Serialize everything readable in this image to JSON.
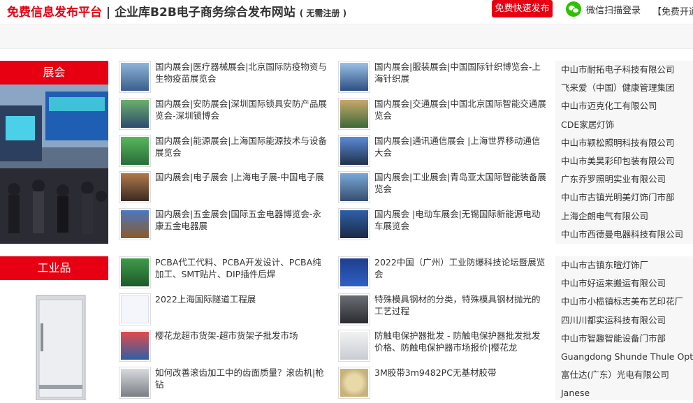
{
  "header": {
    "brand_red": "免费信息发布平台",
    "brand_sep": "|",
    "brand_main": "企业库B2B电子商务综合发布网站",
    "brand_note": "( 无需注册 )",
    "publish_button": "免费快速发布",
    "wechat_login": "微信扫描登录",
    "free_open": "【免费开通"
  },
  "exhibition": {
    "title": "展会",
    "left_col": [
      "国内展会|医疗器械展会|北京国际防疫物资与生物疫苗展览会",
      "国内展会|安防展会|深圳国际锁具安防产品展览会-深圳锁博会",
      "国内展会|能源展会|上海国际能源技术与设备展览会",
      "国内展会|电子展会 |上海电子展-中国电子展",
      "国内展会|五金展会|国际五金电器博览会-永康五金电器展"
    ],
    "right_col": [
      "国内展会|服装展会|中国国际针织博览会-上海针织展",
      "国内展会|交通展会|中国北京国际智能交通展览会",
      "国内展会|通讯通信展会 |上海世界移动通信大会",
      "国内展会|工业展会|青岛亚太国际智能装备展览会",
      "国内展会 |电动车展会|无锡国际新能源电动车展览会"
    ],
    "companies": [
      "中山市耐拓电子科技有限公司",
      "飞来爱（中国）健康管理集团",
      "中山市迈克化工有限公司",
      "CDE家居灯饰",
      "中山市颖松照明科技有限公司",
      "中山市美昊彩印包装有限公司",
      "广东乔罗照明实业有限公司",
      "中山市古镇光明美灯饰门市部",
      "上海企朗电气有限公司",
      "中山市西德曼电器科技有限公司"
    ]
  },
  "industrial": {
    "title": "工业品",
    "left_col": [
      "PCBA代工代料、PCBA开发设计、PCBA纯加工、SMT贴片、DIP插件后焊",
      "2022上海国际隧道工程展",
      "樱花龙超市货架-超市货架子批发市场",
      "如何改善滚齿加工中的齿面质量？滚齿机|枪钻"
    ],
    "right_col": [
      "2022中国（广州）工业防爆科技论坛暨展览会",
      "特殊模具钢材的分类，特殊模具钢材抛光的工艺过程",
      "防触电保护器批发 - 防触电保护器批发批发价格、防触电保护器市场报价|樱花龙",
      "3M胶带3m9482PC无基材胶带"
    ],
    "companies": [
      "中山市古镇东暄灯饰厂",
      "中山市好运来搬运有限公司",
      "中山市小榄镇标志美布艺印花厂",
      "四川川都实运科技有限公司",
      "中山市智趣智能设备门市部",
      "Guangdong Shunde Thule Optoe",
      "富仕达(广东）光电有限公司",
      "Janese"
    ]
  },
  "colors": {
    "accent_red": "#e60012",
    "wechat_green": "#2dc100"
  }
}
